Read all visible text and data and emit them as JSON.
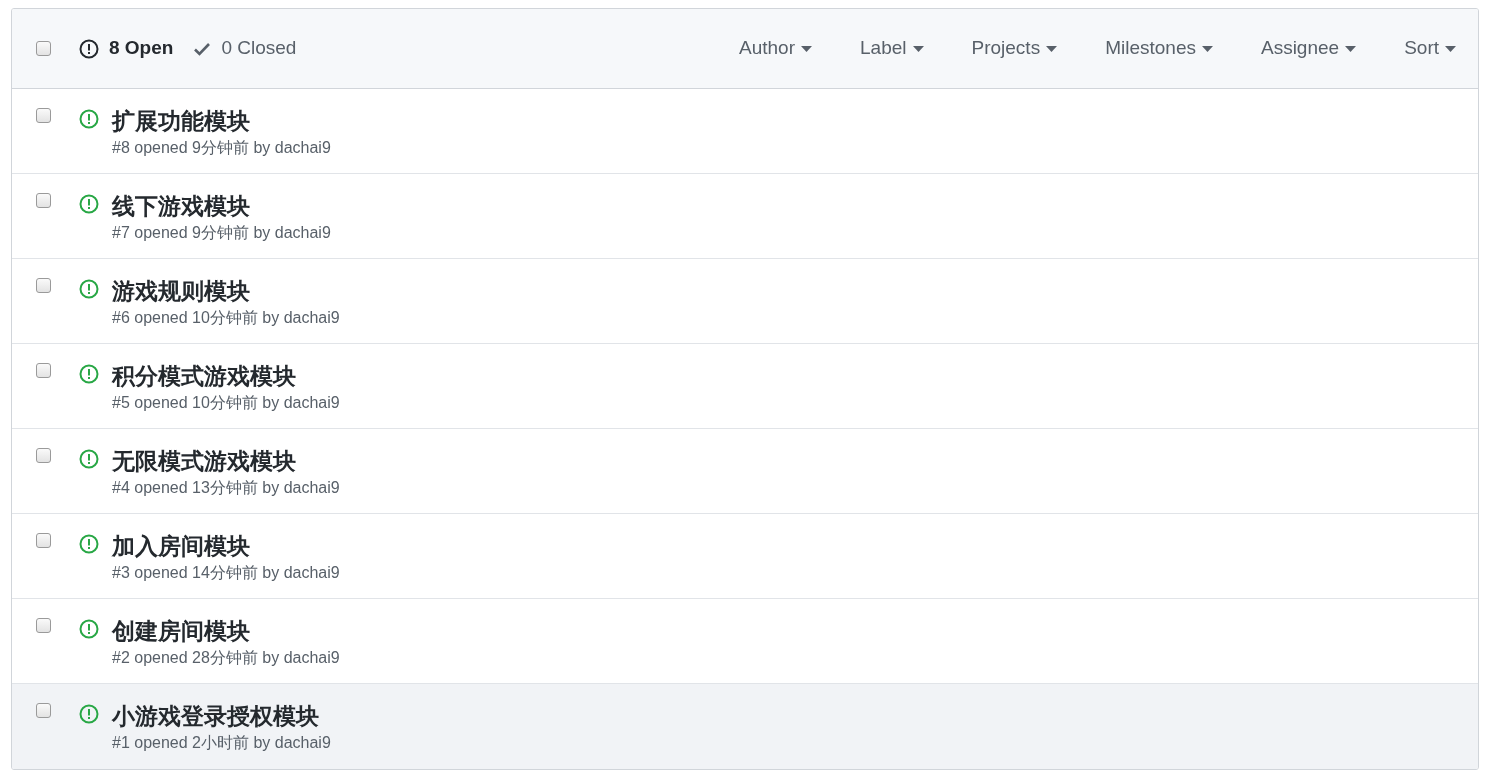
{
  "header": {
    "select_all": {
      "checked": false
    },
    "states": [
      {
        "kind": "open",
        "label": "8 Open",
        "selected": true
      },
      {
        "kind": "closed",
        "label": "0 Closed",
        "selected": false
      }
    ],
    "filters": [
      "Author",
      "Label",
      "Projects",
      "Milestones",
      "Assignee",
      "Sort"
    ]
  },
  "issues": [
    {
      "title": "扩展功能模块",
      "meta": "#8 opened 9分钟前 by dachai9",
      "checked": false,
      "hovered": false
    },
    {
      "title": "线下游戏模块",
      "meta": "#7 opened 9分钟前 by dachai9",
      "checked": false,
      "hovered": false
    },
    {
      "title": "游戏规则模块",
      "meta": "#6 opened 10分钟前 by dachai9",
      "checked": false,
      "hovered": false
    },
    {
      "title": "积分模式游戏模块",
      "meta": "#5 opened 10分钟前 by dachai9",
      "checked": false,
      "hovered": false
    },
    {
      "title": "无限模式游戏模块",
      "meta": "#4 opened 13分钟前 by dachai9",
      "checked": false,
      "hovered": false
    },
    {
      "title": "加入房间模块",
      "meta": "#3 opened 14分钟前 by dachai9",
      "checked": false,
      "hovered": false
    },
    {
      "title": "创建房间模块",
      "meta": "#2 opened 28分钟前 by dachai9",
      "checked": false,
      "hovered": false
    },
    {
      "title": "小游戏登录授权模块",
      "meta": "#1 opened 2小时前 by dachai9",
      "checked": false,
      "hovered": true
    }
  ]
}
